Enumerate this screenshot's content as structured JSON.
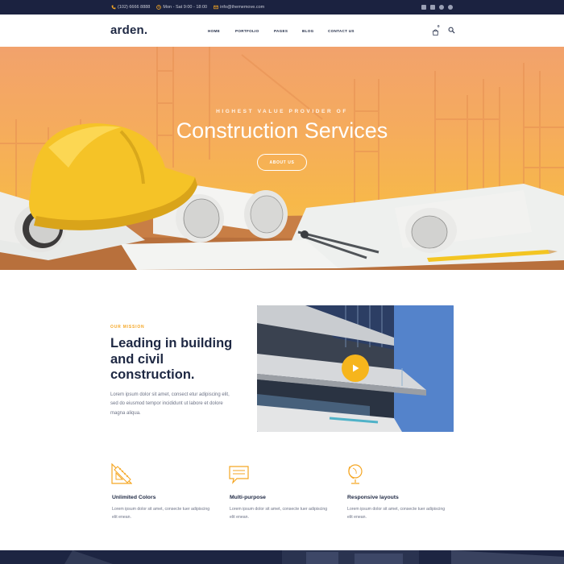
{
  "topbar": {
    "phone": "(102) 6666 8888",
    "hours": "Mon - Sat 9:00 - 18:00",
    "email": "info@thememove.com",
    "social_icons": [
      "facebook-icon",
      "twitter-icon",
      "skype-icon",
      "dribbble-icon"
    ]
  },
  "header": {
    "logo": "arden.",
    "nav": [
      "HOME",
      "PORTFOLIO",
      "PAGES",
      "BLOG",
      "CONTACT US"
    ],
    "cart_count": "0"
  },
  "hero": {
    "subtitle": "HIGHEST VALUE PROVIDER OF",
    "title": "Construction Services",
    "button": "ABOUT US"
  },
  "mission": {
    "label": "OUR MISSION",
    "title": "Leading in building and civil construction.",
    "text": "Lorem ipsum dolor sit amet, consect etur adipiscing elit, sed do eiusmod tempor incididunt ut labore et dolore magna aliqua."
  },
  "features": [
    {
      "icon": "ruler-triangle-icon",
      "title": "Unlimited Colors",
      "text": "Lorem ipsum dolor sit amet, consecte tuer adipiscing elit enean."
    },
    {
      "icon": "chat-bubble-icon",
      "title": "Multi-purpose",
      "text": "Lorem ipsum dolor sit amet, consecte tuer adipiscing elit enean."
    },
    {
      "icon": "globe-stand-icon",
      "title": "Responsive layouts",
      "text": "Lorem ipsum dolor sit amet, consecte tuer adipiscing elit enean."
    }
  ],
  "colors": {
    "accent": "#f5a623",
    "navy": "#1b2240",
    "hero_top": "#f2a26c",
    "hero_bottom": "#f7b84a"
  }
}
